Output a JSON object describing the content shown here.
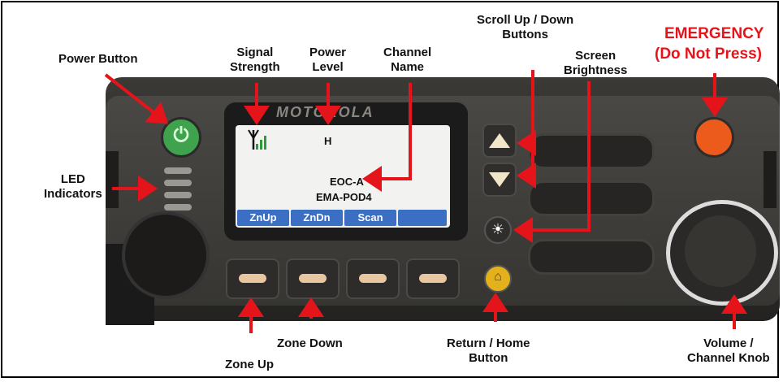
{
  "labels": {
    "power_button": "Power Button",
    "signal_strength": "Signal\nStrength",
    "power_level": "Power\nLevel",
    "channel_name": "Channel\nName",
    "scroll_buttons": "Scroll Up / Down\nButtons",
    "screen_brightness": "Screen\nBrightness",
    "emergency_line1": "EMERGENCY",
    "emergency_line2": "(Do Not Press)",
    "led_indicators": "LED\nIndicators",
    "zone_up": "Zone Up",
    "zone_down": "Zone Down",
    "return_home": "Return / Home\nButton",
    "volume_knob": "Volume /\nChannel Knob"
  },
  "radio": {
    "brand": "MOTOROLA",
    "screen": {
      "power_level": "H",
      "zone_name": "EOC-A",
      "channel_name": "EMA-POD4",
      "softkeys": [
        "ZnUp",
        "ZnDn",
        "Scan",
        ""
      ]
    }
  },
  "colors": {
    "arrow": "#e5141b",
    "emergency_text": "#e5141b",
    "softkey": "#3a6fc4",
    "power_button": "#3fa34d",
    "emergency_button": "#ec5a1c",
    "home_button": "#e2b11c"
  },
  "icons": [
    "power-icon",
    "signal-icon",
    "up-arrow-icon",
    "down-arrow-icon",
    "brightness-icon",
    "home-icon"
  ]
}
